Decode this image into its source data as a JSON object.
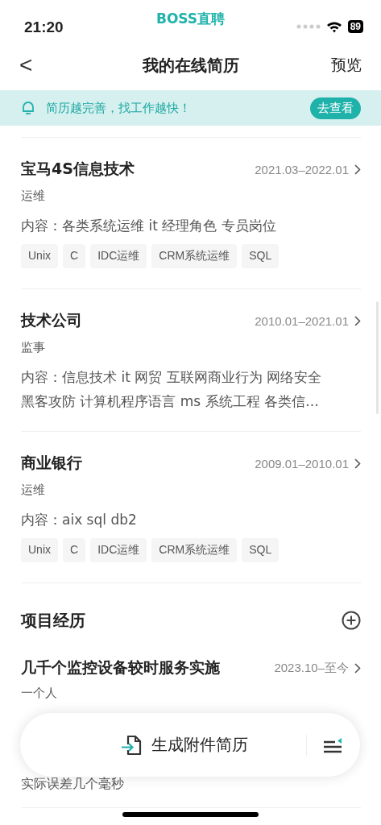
{
  "status_bar": {
    "time": "21:20",
    "app_name": "BOSS直聘",
    "battery": "89"
  },
  "nav": {
    "back": "<",
    "title": "我的在线简历",
    "action": "预览"
  },
  "banner": {
    "text": "简历越完善，找工作越快！",
    "button": "去查看"
  },
  "work_experience": [
    {
      "company": "宝马4S信息技术",
      "period": "2021.03–2022.01",
      "role": "运维",
      "content": "内容：各类系统运维 it  经理角色 专员岗位",
      "tags": [
        "Unix",
        "C",
        "IDC运维",
        "CRM系统运维",
        "SQL"
      ]
    },
    {
      "company": "技术公司",
      "period": "2010.01–2021.01",
      "role": "监事",
      "content": "内容：信息技术 it  网贸 互联网商业行为 网络安全黑客攻防 计算机程序语言 ms  系统工程 各类信…"
    },
    {
      "company": "商业银行",
      "period": "2009.01–2010.01",
      "role": "运维",
      "content": "内容：aix sql db2",
      "tags": [
        "Unix",
        "C",
        "IDC运维",
        "CRM系统运维",
        "SQL"
      ]
    }
  ],
  "projects": {
    "title": "项目经历",
    "items": [
      {
        "name": "几千个监控设备较时服务实施",
        "period": "2023.10–至今",
        "role": "一个人",
        "description_end": "实际误差几个毫秒"
      }
    ]
  },
  "floating_bar": {
    "button": "生成附件简历"
  }
}
